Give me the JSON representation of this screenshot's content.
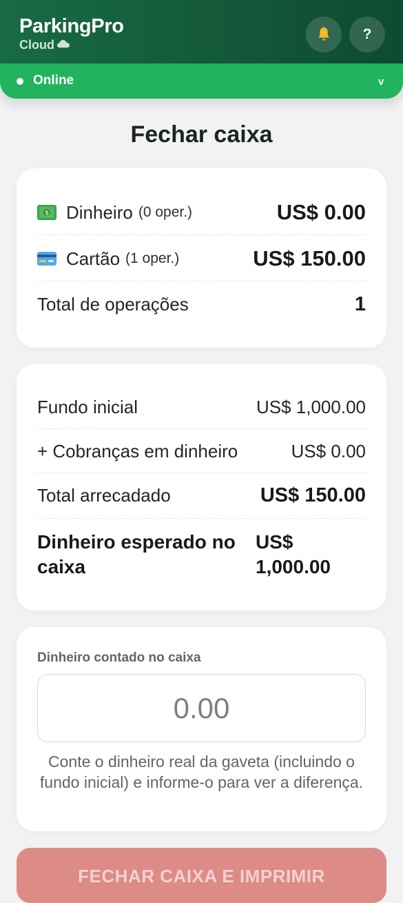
{
  "header": {
    "app_name": "ParkingPro",
    "app_sub": "Cloud",
    "bell_icon": "bell-icon",
    "help_label": "?"
  },
  "status": {
    "label": "Online",
    "chevron": "v",
    "color": "#22b35e"
  },
  "page": {
    "title": "Fechar caixa"
  },
  "summary": {
    "cash": {
      "icon": "cash-icon",
      "label": "Dinheiro",
      "count": "(0 oper.)",
      "amount": "US$ 0.00"
    },
    "card": {
      "icon": "credit-card-icon",
      "label": "Cartão",
      "count": "(1 oper.)",
      "amount": "US$ 150.00"
    },
    "total": {
      "label": "Total de operações",
      "value": "1"
    }
  },
  "reconciliation": {
    "initial_fund": {
      "label": "Fundo inicial",
      "amount": "US$ 1,000.00"
    },
    "cash_charges": {
      "label": "+ Cobranças em dinheiro",
      "amount": "US$ 0.00"
    },
    "total_collected": {
      "label": "Total arrecadado",
      "amount": "US$ 150.00"
    },
    "expected_cash": {
      "label": "Dinheiro esperado no caixa",
      "amount": "US$ 1,000.00"
    }
  },
  "counted": {
    "label": "Dinheiro contado no caixa",
    "placeholder": "0.00",
    "value": "",
    "hint": "Conte o dinheiro real da gaveta (incluindo o fundo inicial) e informe-o para ver a diferença."
  },
  "actions": {
    "close_label": "FECHAR CAIXA E IMPRIMIR",
    "close_color": "#dc8b86"
  }
}
